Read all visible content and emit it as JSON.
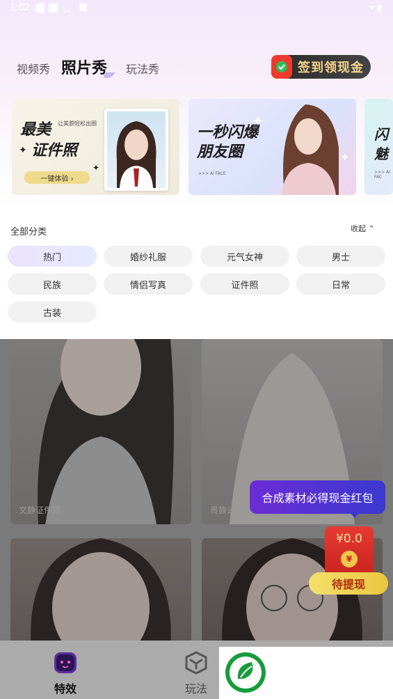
{
  "status_bar": {
    "time": "1:02"
  },
  "tabs": [
    "视频秀",
    "照片秀",
    "玩法秀"
  ],
  "signin": {
    "label": "签到领现金"
  },
  "banners": [
    {
      "title1": "最美",
      "title2": "证件照",
      "subtitle": "让美貌轻松出圈",
      "button": "一键体验 ›"
    },
    {
      "title1": "一秒闪爆",
      "title2": "朋友圈",
      "tag": ">>> AI FACE"
    },
    {
      "title1": "闪",
      "title2": "魅",
      "tag": ">>> AI FAC"
    }
  ],
  "categories": {
    "title": "全部分类",
    "collapse_label": "收起",
    "chips": [
      "热门",
      "婚纱礼服",
      "元气女神",
      "男士",
      "民族",
      "情侣写真",
      "证件照",
      "日常",
      "古装"
    ]
  },
  "cards": [
    {
      "label": "文静证件照"
    },
    {
      "label": "贵族公主风"
    },
    {
      "label": ""
    },
    {
      "label": ""
    }
  ],
  "promo": {
    "bubble": "合成素材必得现金红包",
    "amount": "¥0.0",
    "coin": "¥",
    "withdraw": "待提现"
  },
  "bottom_nav": [
    {
      "label": "特效"
    },
    {
      "label": "玩法"
    }
  ],
  "colors": {
    "accent": "#6c2cd6",
    "gold": "#f5d58d",
    "red": "#e63a32"
  }
}
